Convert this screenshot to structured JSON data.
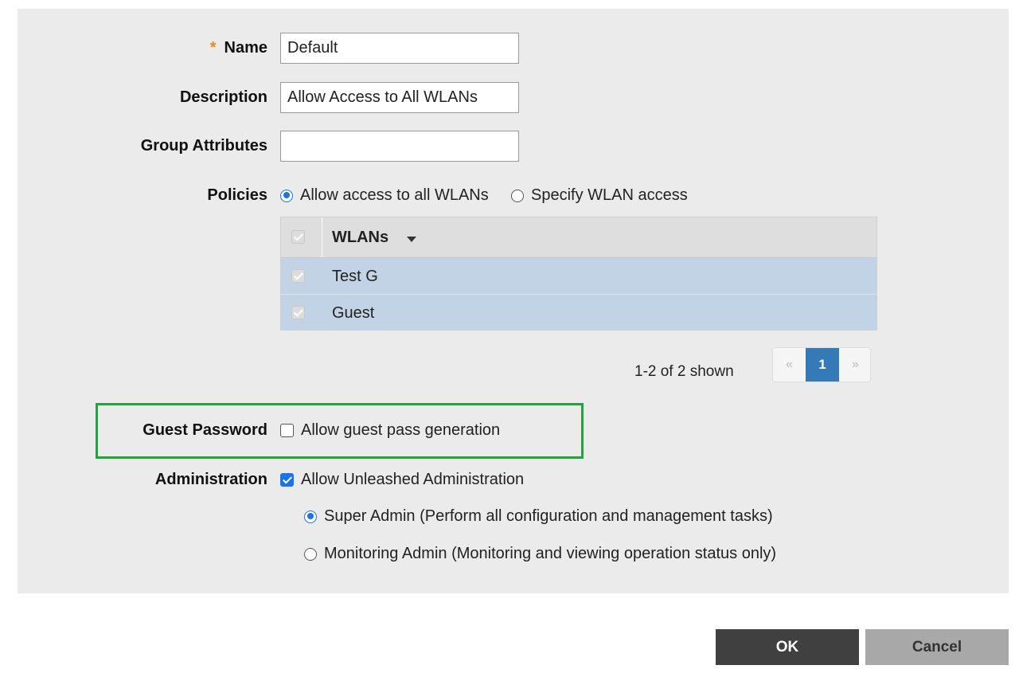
{
  "form": {
    "name": {
      "label": "Name",
      "required_mark": "*",
      "value": "Default"
    },
    "description": {
      "label": "Description",
      "value": "Allow Access to All WLANs"
    },
    "group_attributes": {
      "label": "Group Attributes",
      "value": ""
    },
    "policies": {
      "label": "Policies",
      "options": [
        {
          "label": "Allow access to all WLANs",
          "selected": true
        },
        {
          "label": "Specify WLAN access",
          "selected": false
        }
      ],
      "table": {
        "column_header": "WLANs",
        "rows": [
          {
            "name": "Test G",
            "checked": true
          },
          {
            "name": "Guest",
            "checked": true
          }
        ],
        "pagination": {
          "summary": "1-2 of 2 shown",
          "prev": "«",
          "current_page": "1",
          "next": "»"
        }
      }
    },
    "guest_password": {
      "label": "Guest Password",
      "option": "Allow guest pass generation",
      "checked": false
    },
    "administration": {
      "label": "Administration",
      "option": "Allow Unleashed Administration",
      "checked": true,
      "roles": [
        {
          "label": "Super Admin (Perform all configuration and management tasks)",
          "selected": true
        },
        {
          "label": "Monitoring Admin (Monitoring and viewing operation status only)",
          "selected": false
        }
      ]
    }
  },
  "buttons": {
    "ok": "OK",
    "cancel": "Cancel"
  },
  "colors": {
    "accent": "#1a73e8",
    "highlight_border": "#22a33b",
    "selected_row": "#c2d3e6",
    "page_active": "#337ab7",
    "required": "#e8891c"
  }
}
